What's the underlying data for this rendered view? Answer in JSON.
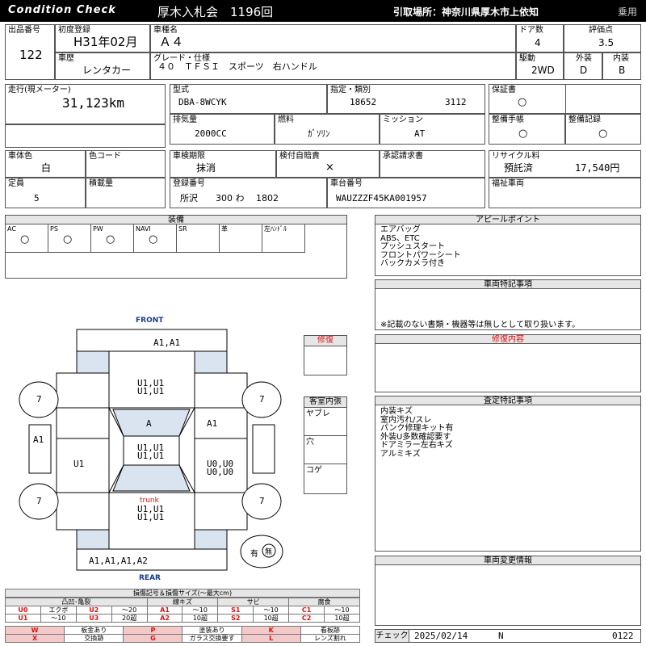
{
  "header": {
    "brand": "Condition Check",
    "auction": "厚木入札会　1196回",
    "pickup": "引取場所：神奈川県厚木市上依知",
    "usage": "乗用"
  },
  "row1": {
    "lot_label": "出品番号",
    "lot": "122",
    "first_reg_label": "初度登録",
    "first_reg": "H31年02月",
    "model_label": "車種名",
    "model": "Ａ４",
    "doors_label": "ドア数",
    "doors": "4",
    "score_label": "評価点",
    "score": "3.5",
    "history_label": "車歴",
    "history": "レンタカー",
    "grade_label": "グレード・仕様",
    "grade": "４０　ＴＦＳＩ　スポーツ　右ハンドル",
    "drive_label": "駆動",
    "drive": "2WD",
    "exterior_label": "外装",
    "exterior": "D",
    "interior_label": "内装",
    "interior": "B"
  },
  "row2": {
    "mileage_label": "走行(現メーター)",
    "mileage": "31,123km",
    "type_label": "型式",
    "type": "DBA-8WCYK",
    "cat_label": "指定・類別",
    "cat1": "18652",
    "cat2": "3112",
    "warranty_label": "保証書",
    "warranty": "○",
    "disp_label": "排気量",
    "disp": "2000CC",
    "fuel_label": "燃料",
    "fuel": "ｶﾞｿﾘﾝ",
    "mission_label": "ミッション",
    "mission": "AT",
    "manual_label": "整備手帳",
    "manual": "○",
    "record_label": "整備記録",
    "record": "○"
  },
  "row3": {
    "color_label": "車体色",
    "color": "白",
    "colorcode_label": "色コード",
    "colorcode": "",
    "inspect_label": "車検期限",
    "inspect": "抹消",
    "insurance_label": "検付自賠責",
    "insurance": "×",
    "approval_label": "承認請求書",
    "approval": "",
    "recycle_label": "リサイクル料",
    "recycle_status": "預託済",
    "recycle_fee": "17,540円",
    "capacity_label": "定員",
    "capacity": "5",
    "load_label": "積載量",
    "load": "",
    "plate_label": "登録番号",
    "plate": "所沢　　300 わ　 1802",
    "vin_label": "車台番号",
    "vin": "WAUZZZF45KA001957",
    "welfare_label": "福祉車両",
    "welfare": ""
  },
  "equipment": {
    "title": "装備",
    "items": [
      {
        "label": "AC",
        "mark": "○"
      },
      {
        "label": "PS",
        "mark": "○"
      },
      {
        "label": "PW",
        "mark": "○"
      },
      {
        "label": "NAVI",
        "mark": "○"
      },
      {
        "label": "SR",
        "mark": ""
      },
      {
        "label": "革",
        "mark": ""
      },
      {
        "label": "左ﾊﾝﾄﾞﾙ",
        "mark": ""
      }
    ]
  },
  "appeal": {
    "title": "アピールポイント",
    "lines": [
      "エアバッグ",
      "ABS、ETC",
      "プッシュスタート",
      "フロントパワーシート",
      "バックカメラ付き"
    ]
  },
  "special": {
    "title": "車両特記事項",
    "note": "※記載のない書類・機器等は無しとして取り扱います。"
  },
  "repair": {
    "title": "修復内容",
    "box_label": "修復"
  },
  "interior": {
    "title": "客室内張",
    "items": [
      "ヤブレ",
      "穴",
      "コゲ"
    ]
  },
  "inspection": {
    "title": "査定特記事項",
    "lines": [
      "内装キズ",
      "室内汚れ/スレ",
      "パンク修理キット有",
      "外装U多数確認要す",
      "ドアミラー左右キズ",
      "アルミキズ"
    ]
  },
  "changes": {
    "title": "車両変更情報"
  },
  "diagram": {
    "front": "FRONT",
    "rear": "REAR",
    "trunk": "trunk",
    "front_bumper": "A1,A1",
    "hood": "U1,U1\nU1,U1",
    "windshield": "A",
    "right_front": "A1",
    "left_mirror": "A1",
    "roof": "U1,U1\nU1,U1",
    "left_side": "U1",
    "right_side": "U0,U0\nU0,U0",
    "trunk_dmg": "U1,U1\nU1,U1",
    "rear_bumper": "A1,A1,A1,A2",
    "wheels": [
      "7",
      "7",
      "7",
      "7"
    ],
    "spare_label": "有",
    "spare_mark": "無"
  },
  "legend": {
    "title": "損傷記号＆損傷サイズ(〜最大cm)",
    "groups": [
      "凸凹･亀裂",
      "線キズ",
      "サビ",
      "腐食"
    ],
    "sub": [
      "エクボ",
      "〜20",
      "〜10",
      "〜10",
      "〜10",
      "〜10",
      "〜10",
      "20超",
      "10超",
      "10超",
      "10超"
    ],
    "row1": [
      {
        "k": "U0",
        "v": "エクボ"
      },
      {
        "k": "U2",
        "v": "〜20"
      },
      {
        "k": "A1",
        "v": "〜10"
      },
      {
        "k": "S1",
        "v": "〜10"
      },
      {
        "k": "C1",
        "v": "〜10"
      }
    ],
    "row2": [
      {
        "k": "U1",
        "v": "〜10"
      },
      {
        "k": "U3",
        "v": "20超"
      },
      {
        "k": "A2",
        "v": "10超"
      },
      {
        "k": "S2",
        "v": "10超"
      },
      {
        "k": "C2",
        "v": "10超"
      }
    ],
    "row3": [
      {
        "k": "W",
        "v": "板金あり"
      },
      {
        "k": "P",
        "v": "塗装あり"
      },
      {
        "k": "K",
        "v": "看板跡"
      }
    ],
    "row4": [
      {
        "k": "X",
        "v": "交換跡"
      },
      {
        "k": "G",
        "v": "ガラス交換要す"
      },
      {
        "k": "L",
        "v": "レンズ割れ"
      }
    ]
  },
  "footer": {
    "check_label": "チェック",
    "date": "2025/02/14",
    "flag": "N",
    "code": "0122"
  }
}
